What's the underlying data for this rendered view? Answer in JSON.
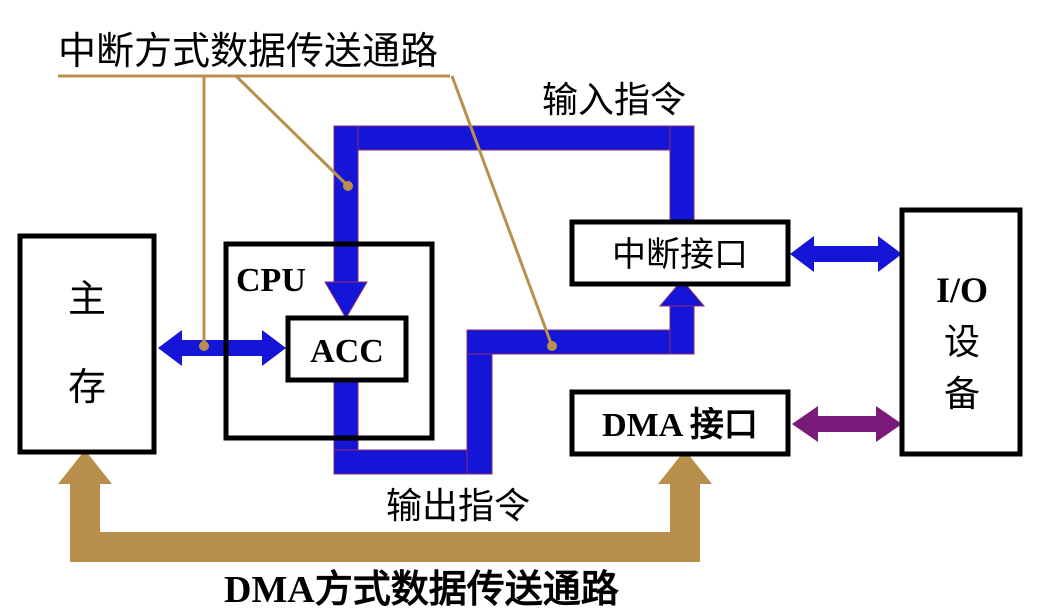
{
  "labels": {
    "interrupt_path": "中断方式数据传送通路",
    "input_instruction": "输入指令",
    "output_instruction": "输出指令",
    "dma_path": "DMA方式数据传送通路"
  },
  "boxes": {
    "main_memory_line1": "主",
    "main_memory_line2": "存",
    "cpu": "CPU",
    "acc": "ACC",
    "interrupt_interface": "中断接口",
    "dma_interface": "DMA 接口",
    "io_line1": "I/O",
    "io_line2": "设",
    "io_line3": "备"
  },
  "colors": {
    "interrupt_bus": "#1515d8",
    "dma_bus": "#b8904c",
    "dma_io_arrow": "#7a1a7a",
    "pointer_lines": "#b8904c",
    "box_border": "#000000"
  }
}
